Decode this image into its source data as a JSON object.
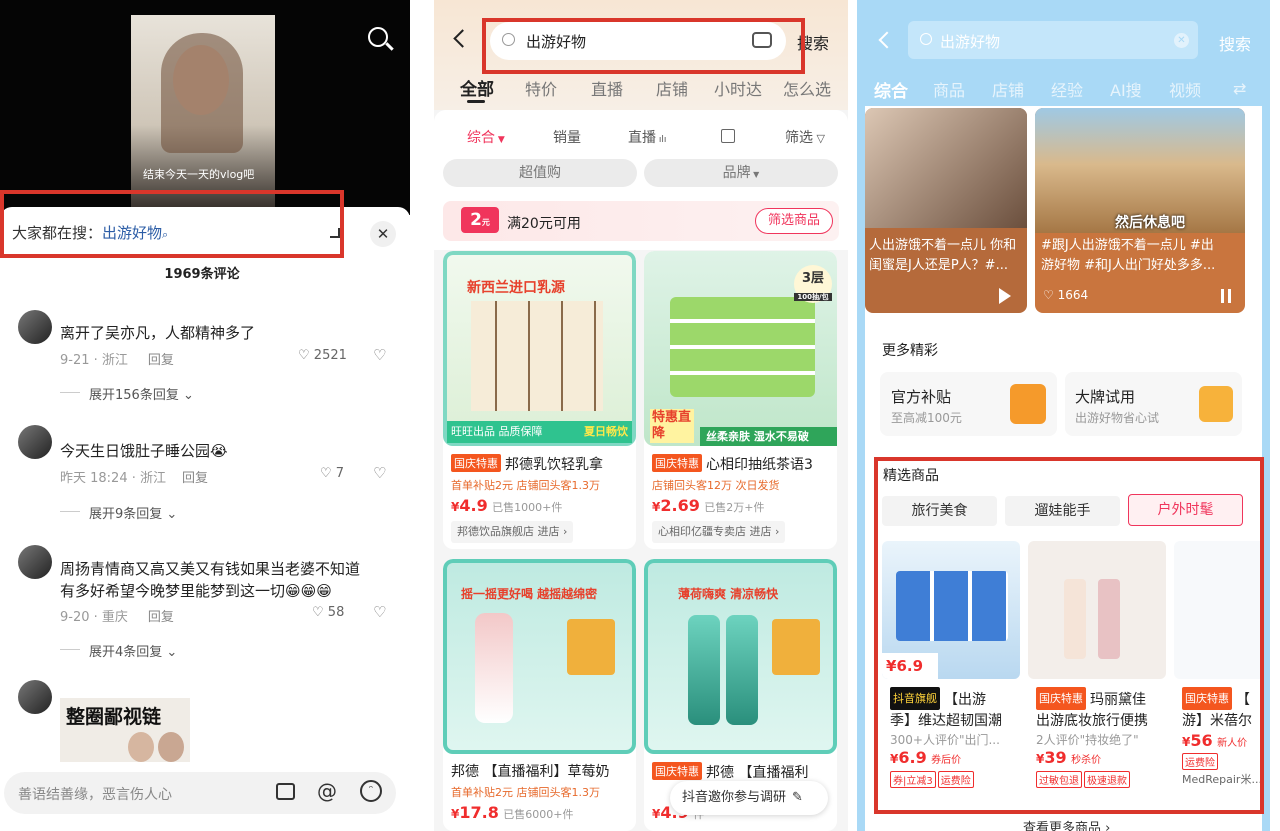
{
  "panel1": {
    "video_caption": "结束今天一天的vlog吧",
    "search_prefix": "大家都在搜：",
    "search_term": "出游好物",
    "comment_count": "1969条评论",
    "comments": [
      {
        "text": "离开了吴亦凡，人都精神多了",
        "meta": "9-21 · 浙江",
        "reply": "回复",
        "likes": "2521",
        "expand": "展开156条回复"
      },
      {
        "text": "今天生日饿肚子睡公园😭",
        "meta": "昨天 18:24 · 浙江",
        "reply": "回复",
        "likes": "7",
        "expand": "展开9条回复"
      },
      {
        "text_line1": "周扬青情商又高又美又有钱如果当老婆不知道",
        "text_line2": "有多好希望今晚梦里能梦到这一切😁😁😁",
        "meta": "9-20 · 重庆",
        "reply": "回复",
        "likes": "58",
        "expand": "展开4条回复"
      }
    ],
    "sticker_text": "整圈鄙视链",
    "input_placeholder": "善语结善缘，恶言伤人心"
  },
  "panel2": {
    "search_text": "出游好物",
    "search_btn": "搜索",
    "tabs": [
      "全部",
      "特价",
      "直播",
      "店铺",
      "小时达",
      "怎么选"
    ],
    "filters": [
      "综合",
      "销量",
      "直播",
      "筛选"
    ],
    "pills": [
      "超值购",
      "品牌"
    ],
    "coupon_amount": "2",
    "coupon_unit": "元",
    "coupon_text": "满20元可用",
    "coupon_btn": "筛选商品",
    "products": [
      {
        "img_title": "新西兰进口乳源",
        "img_foot1": "旺旺出品 品质保障",
        "img_foot2": "夏日畅饮",
        "tag": "国庆特惠",
        "title": "邦德乳饮轻乳拿",
        "sub": "首单补贴2元 店铺回头客1.3万",
        "price_sym": "¥",
        "price": "4.9",
        "sold": "已售1000+件",
        "shop": "邦德饮品旗舰店",
        "enter": "进店 ›"
      },
      {
        "img_title": "特惠直降",
        "img_foot1": "丝柔亲肤 湿水不易破",
        "img_badge": "3层",
        "img_badge_sub": "100抽/包",
        "tag": "国庆特惠",
        "title": "心相印抽纸茶语3",
        "sub": "店铺回头客12万 次日发货",
        "price_sym": "¥",
        "price": "2.69",
        "sold": "已售2万+件",
        "shop": "心相印亿疆专卖店",
        "enter": "进店 ›"
      },
      {
        "img_title": "摇一摇更好喝 越摇越绵密",
        "tag": "",
        "title": "邦德 【直播福利】草莓奶",
        "sub": "首单补贴2元 店铺回头客1.3万",
        "price_sym": "¥",
        "price": "17.8",
        "sold": "已售6000+件"
      },
      {
        "img_title": "薄荷嗨爽 清凉畅快",
        "tag": "国庆特惠",
        "title": "邦德 【直播福利",
        "price_sym": "¥",
        "price": "4.9",
        "sold": "件"
      }
    ],
    "invite_text": "抖音邀你参与调研"
  },
  "panel3": {
    "search_text": "出游好物",
    "search_btn": "搜索",
    "tabs": [
      "综合",
      "商品",
      "店铺",
      "经验",
      "AI搜",
      "视频"
    ],
    "videos": [
      {
        "caption": "人出游饿不着一点儿 你和\n闺蜜是J人还是P人？#..."
      },
      {
        "overlay": "然后休息吧",
        "caption": "#跟J人出游饿不着一点儿 #出\n游好物 #和J人出门好处多多...",
        "likes": "1664"
      }
    ],
    "more_title": "更多精彩",
    "promos": [
      {
        "title": "官方补贴",
        "sub": "至高减100元"
      },
      {
        "title": "大牌试用",
        "sub": "出游好物省心试"
      }
    ],
    "featured_title": "精选商品",
    "chips": [
      "旅行美食",
      "遛娃能手",
      "户外时髦"
    ],
    "products": [
      {
        "tag": "抖音旗舰",
        "title1": "【出游",
        "title2": "季】维达超韧国潮",
        "review": "300+人评价\"出门...",
        "price": "6.9",
        "price_label": "券后价",
        "coupons": [
          "券|立减3",
          "运费险"
        ]
      },
      {
        "tag": "国庆特惠",
        "title1": "玛丽黛佳",
        "title2": "出游底妆旅行便携",
        "review": "2人评价\"持妆绝了\"",
        "price": "39",
        "price_label": "秒杀价",
        "coupons": [
          "过敏包退",
          "极速退款"
        ]
      },
      {
        "tag": "国庆特惠",
        "title1": "【",
        "title2": "游】米蓓尔",
        "price": "56",
        "price_label": "新人价",
        "coupons": [
          "运费险"
        ],
        "shop": "MedRepair米..."
      }
    ],
    "more_products": "查看更多商品 ›"
  }
}
